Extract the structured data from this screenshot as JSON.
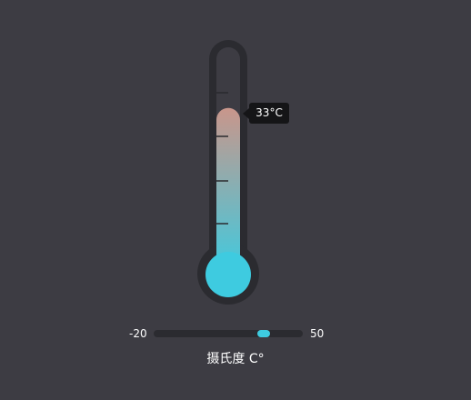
{
  "thermometer": {
    "min": -20,
    "max": 50,
    "value": 33,
    "value_label": "33°C",
    "colors": {
      "background": "#3d3c43",
      "tube": "#2b2b30",
      "mercury_top": "#c9968b",
      "mercury_bottom": "#3ecbe0"
    }
  },
  "slider": {
    "min_label": "-20",
    "max_label": "50"
  },
  "unit_label": "摄氏度 C°"
}
